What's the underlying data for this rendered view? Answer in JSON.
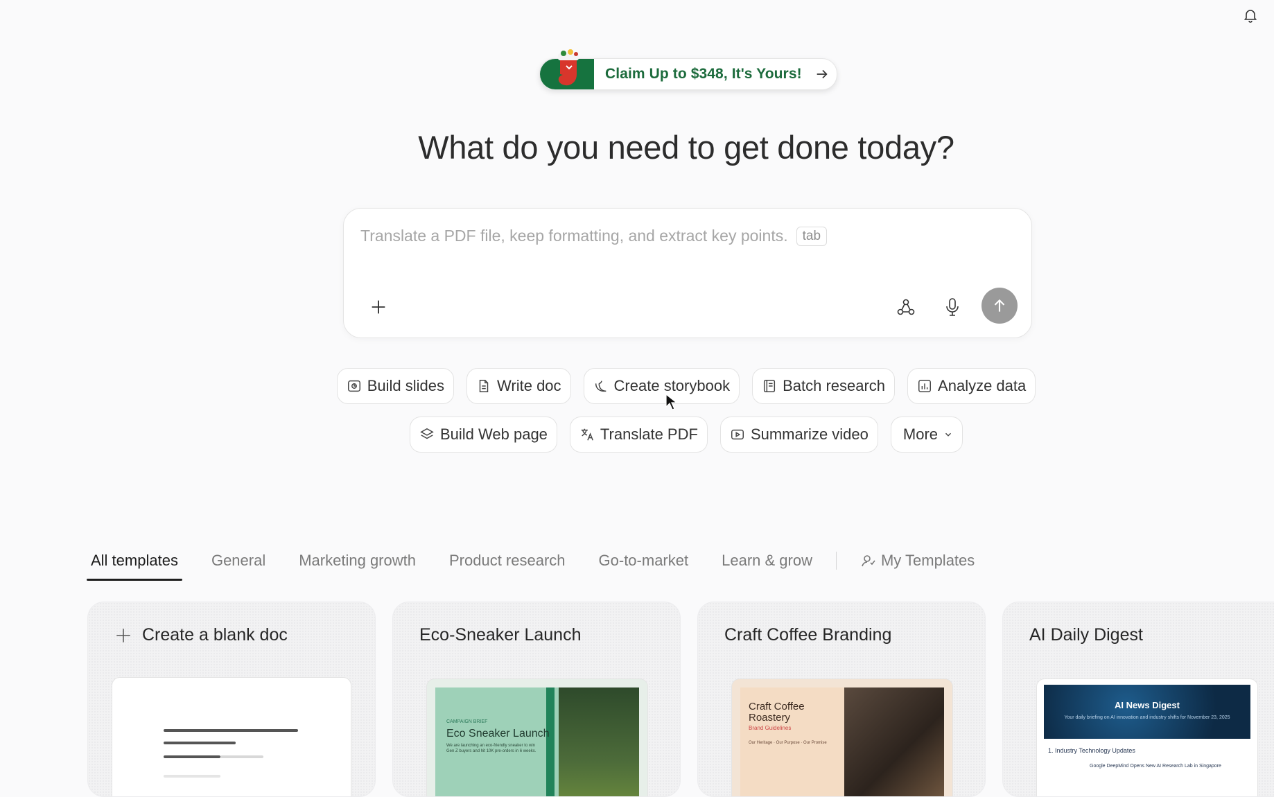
{
  "promo": {
    "text": "Claim Up to $348, It's Yours!"
  },
  "headline": "What do you need to get done today?",
  "prompt": {
    "placeholder": "Translate a PDF file, keep formatting, and extract key points.",
    "kbd": "tab"
  },
  "chips_row1": [
    "Build slides",
    "Write doc",
    "Create storybook",
    "Batch research",
    "Analyze data"
  ],
  "chips_row2": [
    "Build Web page",
    "Translate PDF",
    "Summarize video",
    "More"
  ],
  "tabs": [
    "All templates",
    "General",
    "Marketing growth",
    "Product research",
    "Go-to-market",
    "Learn & grow"
  ],
  "my_templates": "My Templates",
  "cards": [
    {
      "title": "Create a blank doc"
    },
    {
      "title": "Eco-Sneaker Launch",
      "thumb_label": "CAMPAIGN BRIEF",
      "thumb_title": "Eco Sneaker Launch",
      "thumb_body": "We are launching an eco-friendly sneaker to win Gen Z buyers and hit 10K pre-orders in 6 weeks."
    },
    {
      "title": "Craft Coffee Branding",
      "thumb_title": "Craft Coffee Roastery",
      "thumb_sub": "Brand Guidelines",
      "thumb_body": "Our Heritage · Our Purpose · Our Promise"
    },
    {
      "title": "AI Daily Digest",
      "thumb_title": "AI News Digest",
      "thumb_sub": "Your daily briefing on AI innovation and industry shifts for November 23, 2025",
      "thumb_item": "1. Industry Technology Updates",
      "thumb_headline": "Google DeepMind Opens New AI Research Lab in Singapore"
    }
  ]
}
